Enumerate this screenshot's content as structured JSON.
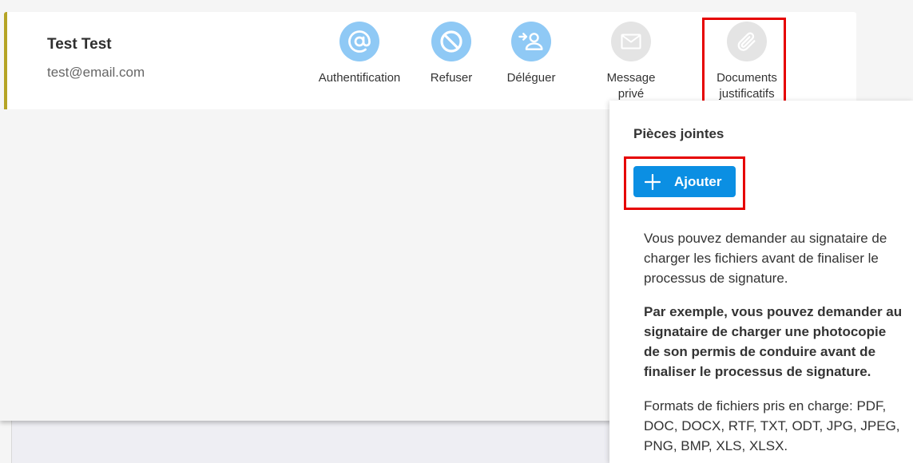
{
  "signer": {
    "name": "Test Test",
    "email": "test@email.com"
  },
  "actions": [
    {
      "label": "Authentification",
      "icon": "at-sign-icon",
      "color": "#8fc9f5"
    },
    {
      "label": "Refuser",
      "icon": "block-icon",
      "color": "#8fc9f5"
    },
    {
      "label": "Déléguer",
      "icon": "delegate-user-icon",
      "color": "#8fc9f5"
    },
    {
      "label": "Message privé",
      "icon": "envelope-icon",
      "color": "#e4e4e4"
    },
    {
      "label": "Documents justificatifs",
      "icon": "paperclip-icon",
      "color": "#e4e4e4"
    }
  ],
  "attachments_panel": {
    "title": "Pièces jointes",
    "add_label": "Ajouter",
    "description": "Vous pouvez demander au signataire de charger les fichiers avant de finaliser le processus de signature.",
    "example": "Par exemple, vous pouvez demander au signataire de charger une photocopie de son permis de conduire avant de finaliser le processus de signature.",
    "formats": "Formats de fichiers pris en charge: PDF, DOC, DOCX, RTF, TXT, ODT, JPG, JPEG, PNG, BMP, XLS, XLSX."
  },
  "colors": {
    "accent_bar": "#b5a425",
    "primary_button": "#0b8fe3",
    "highlight": "#e60000"
  }
}
